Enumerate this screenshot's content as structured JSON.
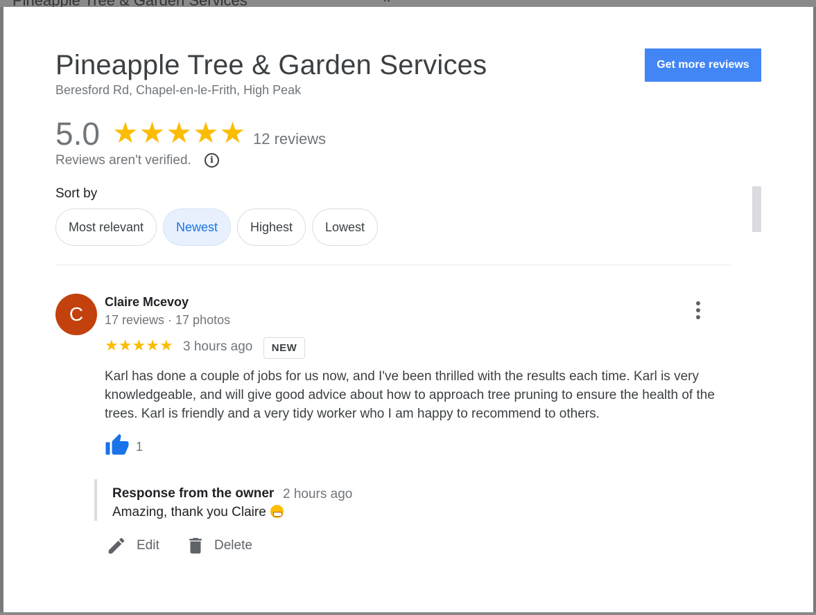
{
  "background": {
    "partial_title": "Pineapple Tree & Garden Services",
    "close_glyph": "×"
  },
  "business": {
    "name": "Pineapple Tree & Garden Services",
    "address": "Beresford Rd, Chapel-en-le-Frith, High Peak"
  },
  "get_more_reviews": "Get more reviews",
  "rating": {
    "value": "5.0",
    "stars": 5,
    "review_count": "12 reviews",
    "verification_note": "Reviews aren't verified.",
    "info_glyph": "i"
  },
  "sort": {
    "label": "Sort by",
    "options": [
      "Most relevant",
      "Newest",
      "Highest",
      "Lowest"
    ],
    "selected": "Newest"
  },
  "review": {
    "avatar_letter": "C",
    "avatar_color": "#c2410c",
    "author": "Claire Mcevoy",
    "meta": "17 reviews · 17 photos",
    "stars": 5,
    "time": "3 hours ago",
    "badge": "NEW",
    "text": "Karl has done a couple of jobs for us now, and I've been thrilled with the results each time. Karl is very knowledgeable, and will give good advice about how to approach tree pruning to ensure the health of the trees. Karl is friendly and a very tidy worker who I am happy to recommend to others.",
    "likes": "1",
    "owner_response": {
      "title": "Response from the owner",
      "time": "2 hours ago",
      "text": "Amazing, thank you Claire"
    }
  },
  "actions": {
    "edit": "Edit",
    "delete": "Delete"
  },
  "colors": {
    "accent": "#4285f4",
    "star": "#fbbc04",
    "chip_active_bg": "#e8f0fe",
    "chip_active_text": "#1a73e8",
    "like": "#1a73e8"
  }
}
